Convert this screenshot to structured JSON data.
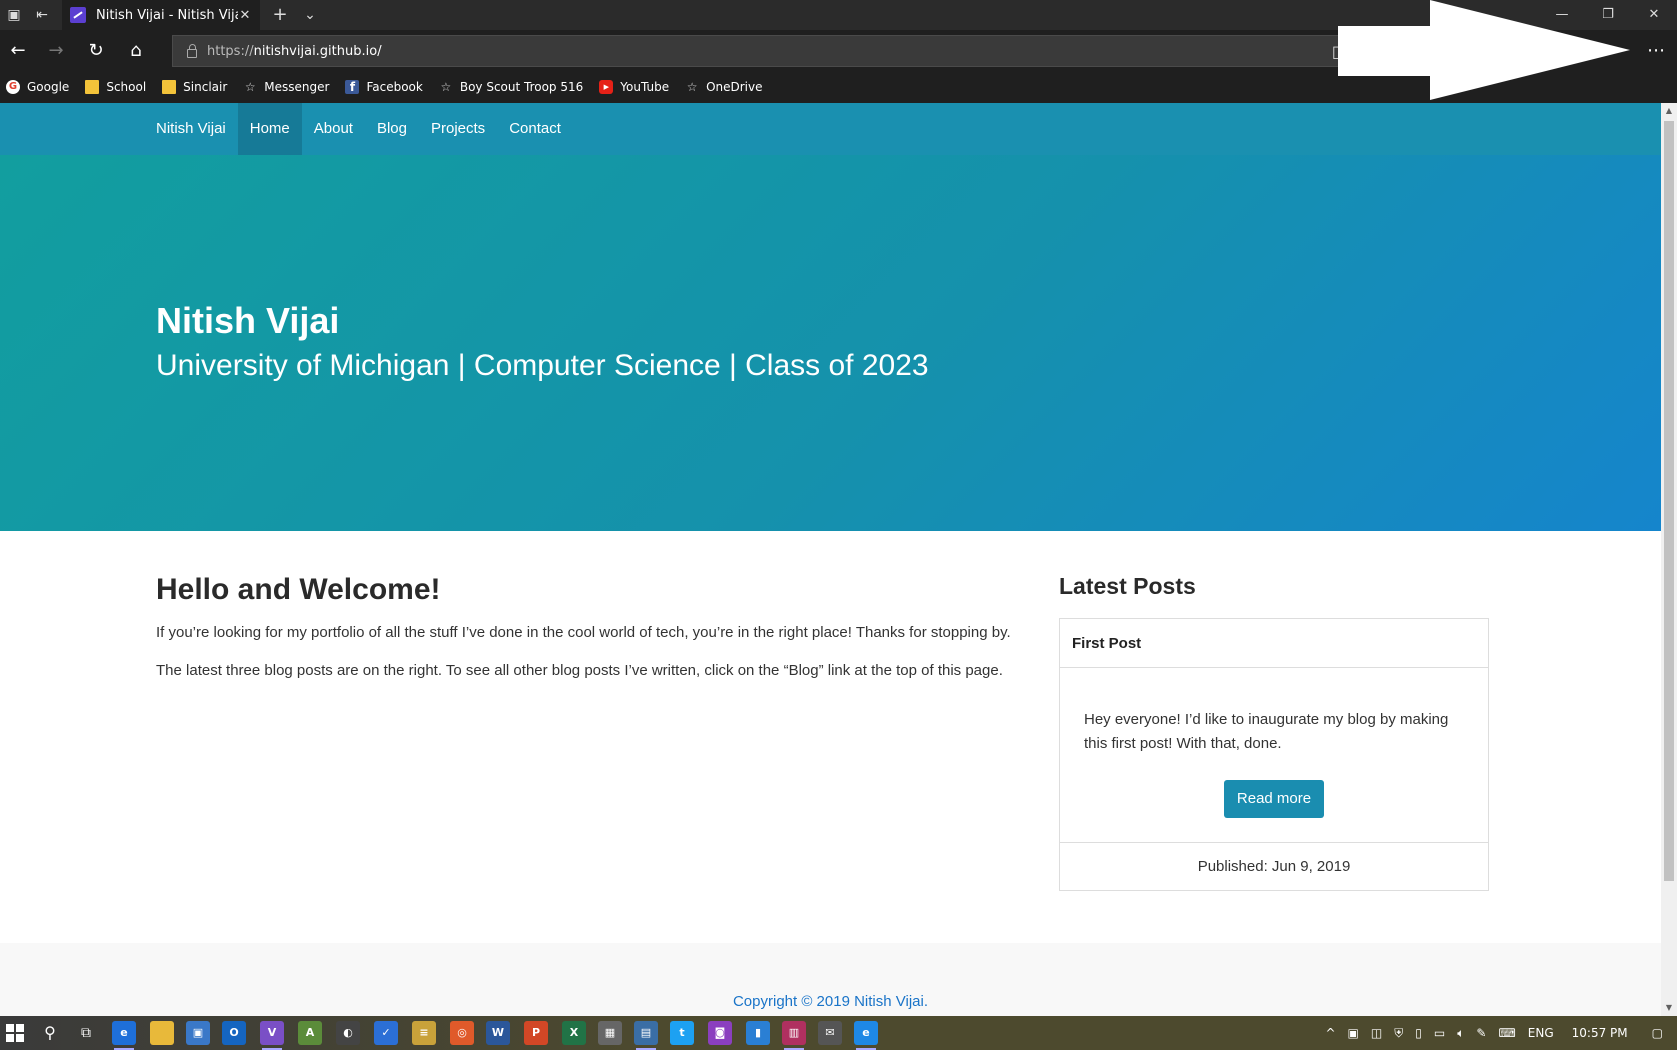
{
  "browser": {
    "tab_title": "Nitish Vijai - Nitish Vijai",
    "url_protocol": "https://",
    "url_host": "nitishvijai.github.io/",
    "bookmarks": [
      {
        "label": "Google",
        "icon": "google-icon"
      },
      {
        "label": "School",
        "icon": "folder-icon"
      },
      {
        "label": "Sinclair",
        "icon": "folder-icon"
      },
      {
        "label": "Messenger",
        "icon": "star-icon"
      },
      {
        "label": "Facebook",
        "icon": "facebook-icon"
      },
      {
        "label": "Boy Scout Troop 516",
        "icon": "star-icon"
      },
      {
        "label": "YouTube",
        "icon": "youtube-icon"
      },
      {
        "label": "OneDrive",
        "icon": "star-icon"
      }
    ]
  },
  "site": {
    "nav": {
      "brand": "Nitish Vijai",
      "links": [
        "Home",
        "About",
        "Blog",
        "Projects",
        "Contact"
      ],
      "active": "Home"
    },
    "hero": {
      "title": "Nitish Vijai",
      "subtitle": "University of Michigan | Computer Science | Class of 2023"
    },
    "main": {
      "heading": "Hello and Welcome!",
      "paragraphs": [
        "If you’re looking for my portfolio of all the stuff I’ve done in the cool world of tech, you’re in the right place! Thanks for stopping by.",
        "The latest three blog posts are on the right. To see all other blog posts I’ve written, click on the “Blog” link at the top of this page."
      ]
    },
    "sidebar": {
      "heading": "Latest Posts",
      "post": {
        "title": "First Post",
        "excerpt": "Hey everyone! I’d like to inaugurate my blog by making this first post! With that, done.",
        "button": "Read more",
        "published": "Published: Jun 9, 2019"
      }
    },
    "footer": {
      "copyright": "Copyright © 2019 Nitish Vijai."
    }
  },
  "taskbar": {
    "language": "ENG",
    "time": "10:57 PM"
  },
  "colors": {
    "nav_bg": "#1a90b0",
    "hero_start": "#129e9f",
    "hero_end": "#1585cc",
    "button": "#1a8db0",
    "footer_link": "#1a74c8"
  }
}
